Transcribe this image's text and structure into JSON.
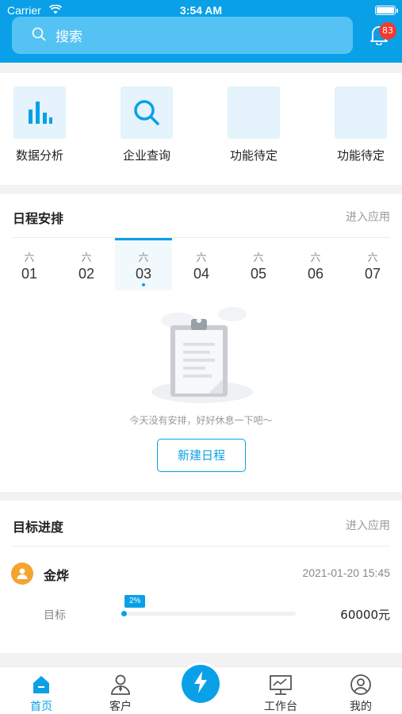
{
  "status_bar": {
    "carrier": "Carrier",
    "time": "3:54 AM"
  },
  "search": {
    "placeholder": "搜索"
  },
  "notifications": {
    "badge_count": "83"
  },
  "quick_actions": [
    {
      "label": "数据分析",
      "icon": "bar-chart-icon"
    },
    {
      "label": "企业查询",
      "icon": "search-icon"
    },
    {
      "label": "功能待定",
      "icon": ""
    },
    {
      "label": "功能待定",
      "icon": ""
    }
  ],
  "schedule": {
    "title": "日程安排",
    "link": "进入应用",
    "days": [
      {
        "weekday": "六",
        "date": "01"
      },
      {
        "weekday": "六",
        "date": "02"
      },
      {
        "weekday": "六",
        "date": "03"
      },
      {
        "weekday": "六",
        "date": "04"
      },
      {
        "weekday": "六",
        "date": "05"
      },
      {
        "weekday": "六",
        "date": "06"
      },
      {
        "weekday": "六",
        "date": "07"
      }
    ],
    "selected_day": "03",
    "empty_text": "今天没有安排，好好休息一下吧～",
    "new_button": "新建日程"
  },
  "goal": {
    "title": "目标进度",
    "link": "进入应用",
    "name": "金烨",
    "date": "2021-01-20 15:45",
    "target_label": "目标",
    "progress_label": "2%",
    "progress": 0.02,
    "target_value": "60000元"
  },
  "tabs": [
    {
      "label": "首页",
      "icon": "home-icon",
      "active": true
    },
    {
      "label": "客户",
      "icon": "customer-icon",
      "active": false
    },
    {
      "label": "工作台",
      "icon": "workbench-icon",
      "active": false
    },
    {
      "label": "我的",
      "icon": "profile-icon",
      "active": false
    }
  ],
  "colors": {
    "accent": "#0aa0e8",
    "badge": "#f23a2f",
    "avatar": "#f5a431"
  }
}
